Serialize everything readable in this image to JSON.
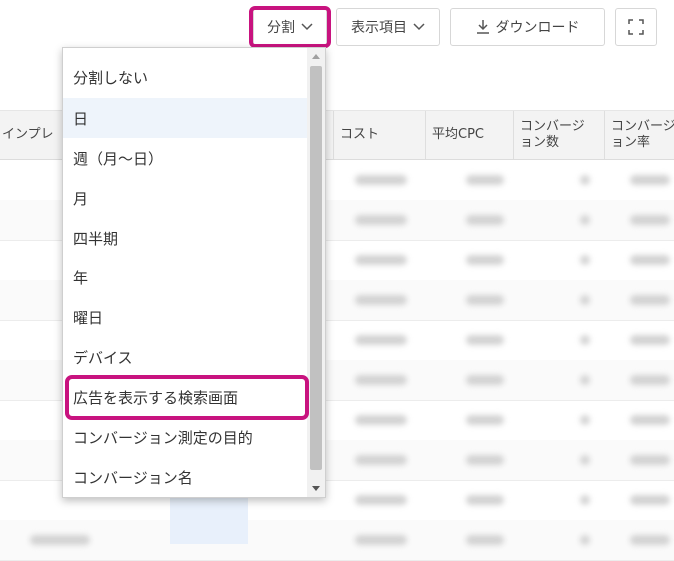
{
  "toolbar": {
    "split_label": "分割",
    "columns_label": "表示項目",
    "download_label": "ダウンロード",
    "chevron_icon": "chevron-down-icon",
    "download_icon": "download-icon",
    "expand_icon": "fullscreen-icon"
  },
  "table": {
    "headers": [
      {
        "label": "インプレ"
      },
      {
        "label": "コスト"
      },
      {
        "label": "平均CPC"
      },
      {
        "label": "コンバージ\nョン数"
      },
      {
        "label": "コンバージ\nョン率"
      }
    ]
  },
  "split_menu": {
    "items": [
      {
        "label": "分割しない"
      },
      {
        "label": "日"
      },
      {
        "label": "週（月〜日）"
      },
      {
        "label": "月"
      },
      {
        "label": "四半期"
      },
      {
        "label": "年"
      },
      {
        "label": "曜日"
      },
      {
        "label": "デバイス"
      },
      {
        "label": "広告を表示する検索画面"
      },
      {
        "label": "コンバージョン測定の目的"
      },
      {
        "label": "コンバージョン名"
      }
    ],
    "selected_index": 1,
    "highlighted_index": 8
  },
  "colors": {
    "highlight": "#c8137f",
    "selected_bg": "#eef4fb"
  }
}
